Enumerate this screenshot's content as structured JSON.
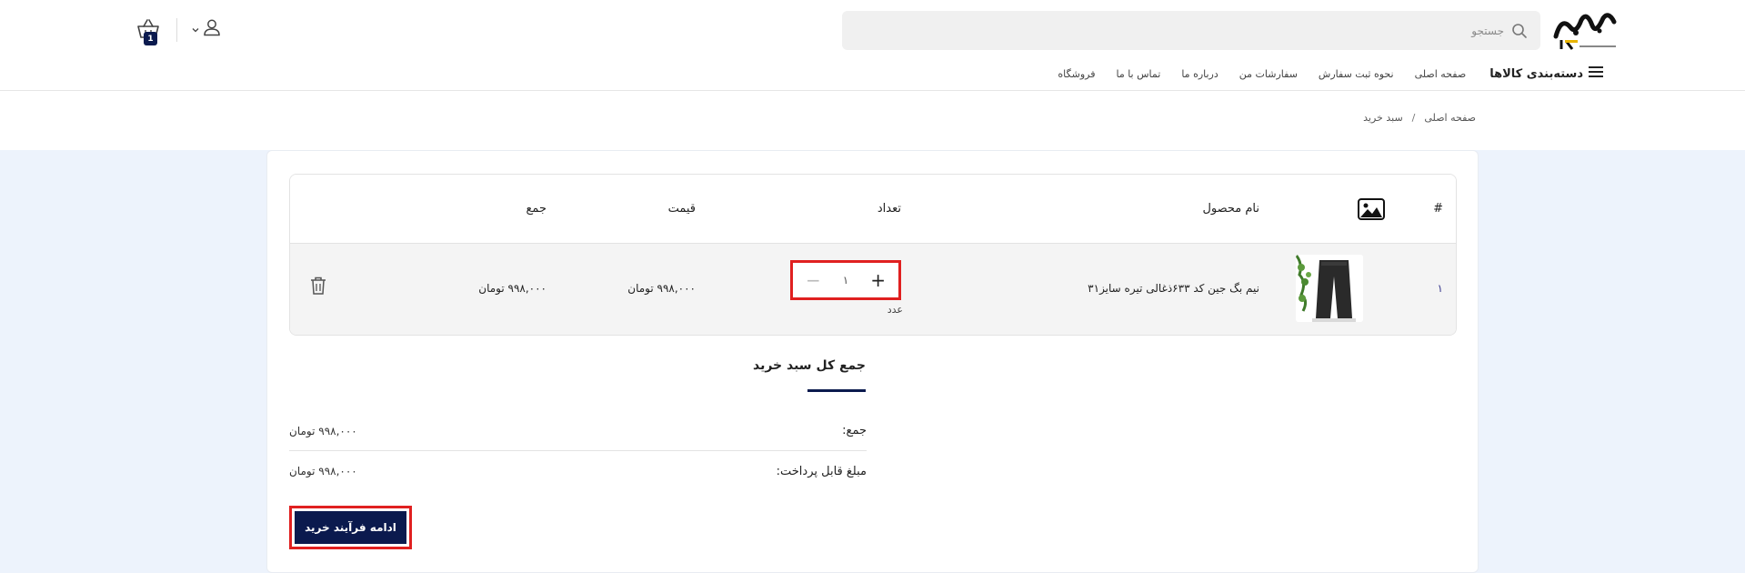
{
  "header": {
    "search": {
      "placeholder": "جستجو"
    },
    "cart_count": "1",
    "nav": {
      "categories_label": "دسته‌بندی کالاها",
      "items": [
        {
          "label": "صفحه اصلی"
        },
        {
          "label": "نحوه ثبت سفارش"
        },
        {
          "label": "سفارشات من"
        },
        {
          "label": "درباره ما"
        },
        {
          "label": "تماس با ما"
        },
        {
          "label": "فروشگاه"
        }
      ]
    }
  },
  "breadcrumb": {
    "items": [
      {
        "label": "صفحه اصلی"
      },
      {
        "label": "سبد خرید"
      }
    ],
    "separator": "/"
  },
  "cart_table": {
    "headers": {
      "index": "#",
      "product_name": "نام محصول",
      "quantity": "تعداد",
      "price": "قیمت",
      "total": "جمع"
    },
    "rows": [
      {
        "index": "۱",
        "product_name": "نیم بگ جین کد ۶۳۳ذغالی تیره سایز۳۱",
        "quantity": "۱",
        "unit": "عدد",
        "price": "۹۹۸,۰۰۰ تومان",
        "total": "۹۹۸,۰۰۰ تومان"
      }
    ]
  },
  "totals": {
    "title": "جمع کل سبد خرید",
    "subtotal_label": "جمع:",
    "subtotal_value": "۹۹۸,۰۰۰ تومان",
    "payable_label": "مبلغ قابل پرداخت:",
    "payable_value": "۹۹۸,۰۰۰ تومان",
    "checkout_label": "ادامه فرآیند خرید"
  },
  "colors": {
    "primary": "#0b1a4e",
    "highlight": "#e02020",
    "page_bg": "#edf3fc"
  }
}
